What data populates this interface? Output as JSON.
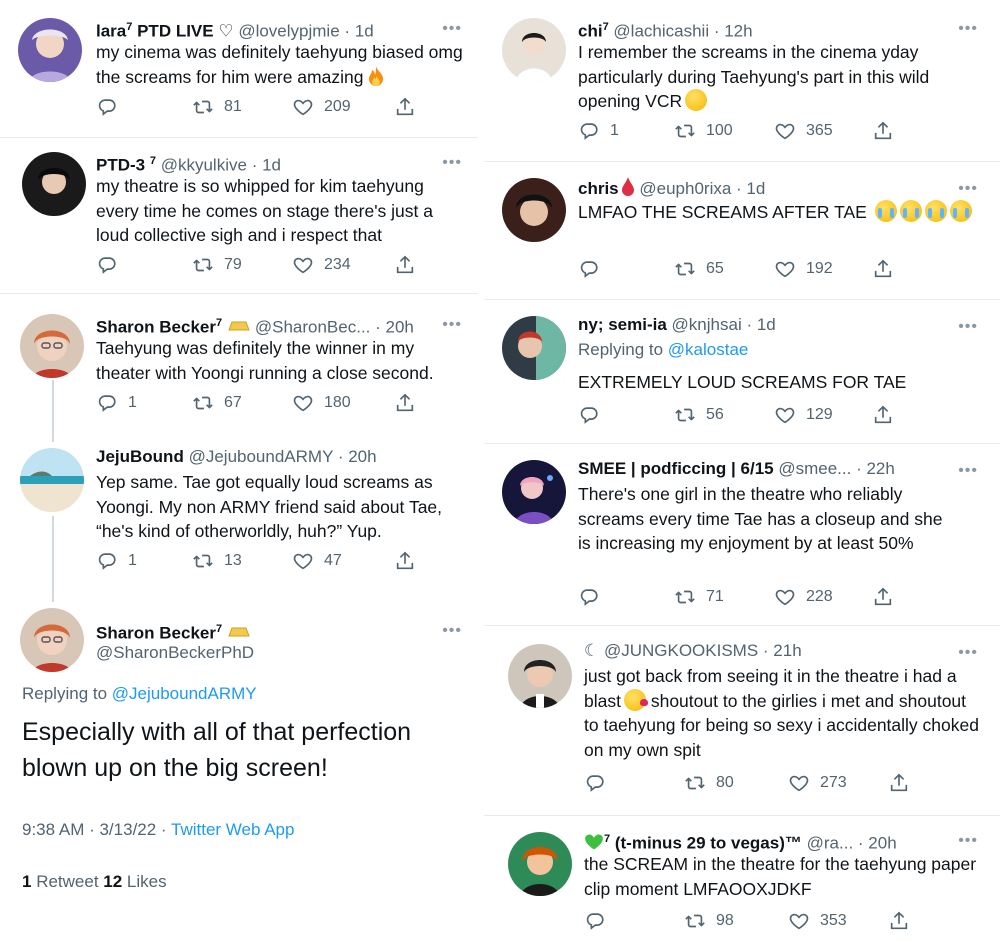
{
  "left": {
    "t1": {
      "name": "lara",
      "sup": "7",
      "suffix": " PTD LIVE ♡",
      "handle": "@lovelypjmie",
      "time": "· 1d",
      "text": "my cinema was definitely taehyung biased omg the screams for him were amazing",
      "retweets": "81",
      "likes": "209"
    },
    "t2": {
      "name": "PTD-3",
      "sup": "7",
      "handle": "@kkyulkive",
      "time": "· 1d",
      "text": "my theatre is so whipped for kim taehyung every time he comes on stage there's just a loud collective sigh and i respect that",
      "retweets": "79",
      "likes": "234"
    },
    "t3": {
      "name": "Sharon Becker",
      "sup": "7",
      "handle": "@SharonBec...",
      "time": "· 20h",
      "text": "Taehyung was definitely the winner in my theater with Yoongi running a close second.",
      "replies": "1",
      "retweets": "67",
      "likes": "180"
    },
    "t4": {
      "name": "JejuBound",
      "handle": "@JejuboundARMY",
      "time": "· 20h",
      "text": "Yep same. Tae got equally loud screams as Yoongi. My non ARMY friend said about Tae, “he's kind of otherworldly, huh?” Yup.",
      "replies": "1",
      "retweets": "13",
      "likes": "47"
    },
    "main": {
      "name": "Sharon Becker",
      "sup": "7",
      "handle": "@SharonBeckerPhD",
      "replying_prefix": "Replying to ",
      "replying_to": "@JejuboundARMY",
      "text": "Especially with all of that perfection blown up on the big screen!",
      "timestamp": "9:38 AM · 3/13/22 · ",
      "source": "Twitter Web App",
      "retweet_count": "1",
      "retweet_label": " Retweet  ",
      "like_count": "12",
      "like_label": " Likes"
    }
  },
  "right": {
    "t1": {
      "name": "chi",
      "sup": "7",
      "handle": "@lachicashii",
      "time": "· 12h",
      "text": "I remember the screams in the cinema yday particularly during Taehyung's part in this wild opening VCR",
      "replies": "1",
      "retweets": "100",
      "likes": "365"
    },
    "t2": {
      "name": "chris",
      "handle": "@euph0rixa",
      "time": "· 1d",
      "text": "LMFAO THE SCREAMS AFTER TAE",
      "retweets": "65",
      "likes": "192"
    },
    "t3": {
      "name": "ny; semi-ia",
      "handle": "@knjhsai",
      "time": "· 1d",
      "replying_prefix": "Replying to ",
      "replying_to": "@kalostae",
      "text": "EXTREMELY LOUD SCREAMS FOR TAE",
      "retweets": "56",
      "likes": "129"
    },
    "t4": {
      "name": "SMEE | podficcing | 6/15",
      "handle": "@smee...",
      "time": "· 22h",
      "text": "There's one girl in the theatre who reliably screams every time Tae has a closeup and she is increasing my enjoyment by at least 50%",
      "retweets": "71",
      "likes": "228"
    },
    "t5": {
      "name": "☾ @JUNGKOOKISMS",
      "time": "· 21h",
      "text_a": "just got back from seeing it in the theatre i had a blast",
      "text_b": " shoutout to the girlies i met and shoutout to taehyung for being so sexy i accidentally choked on my own spit",
      "retweets": "80",
      "likes": "273"
    },
    "t6": {
      "name_sup": "7",
      "name": " (t-minus 29 to vegas)™",
      "handle": "@ra...",
      "time": "· 20h",
      "text": "the SCREAM in the theatre for the taehyung paper clip moment LMFAOOXJDKF",
      "retweets": "98",
      "likes": "353"
    }
  },
  "more_icon": "•••",
  "colors": {
    "link": "#1d9bf0",
    "secondary": "#536471",
    "text": "#0f1419"
  }
}
